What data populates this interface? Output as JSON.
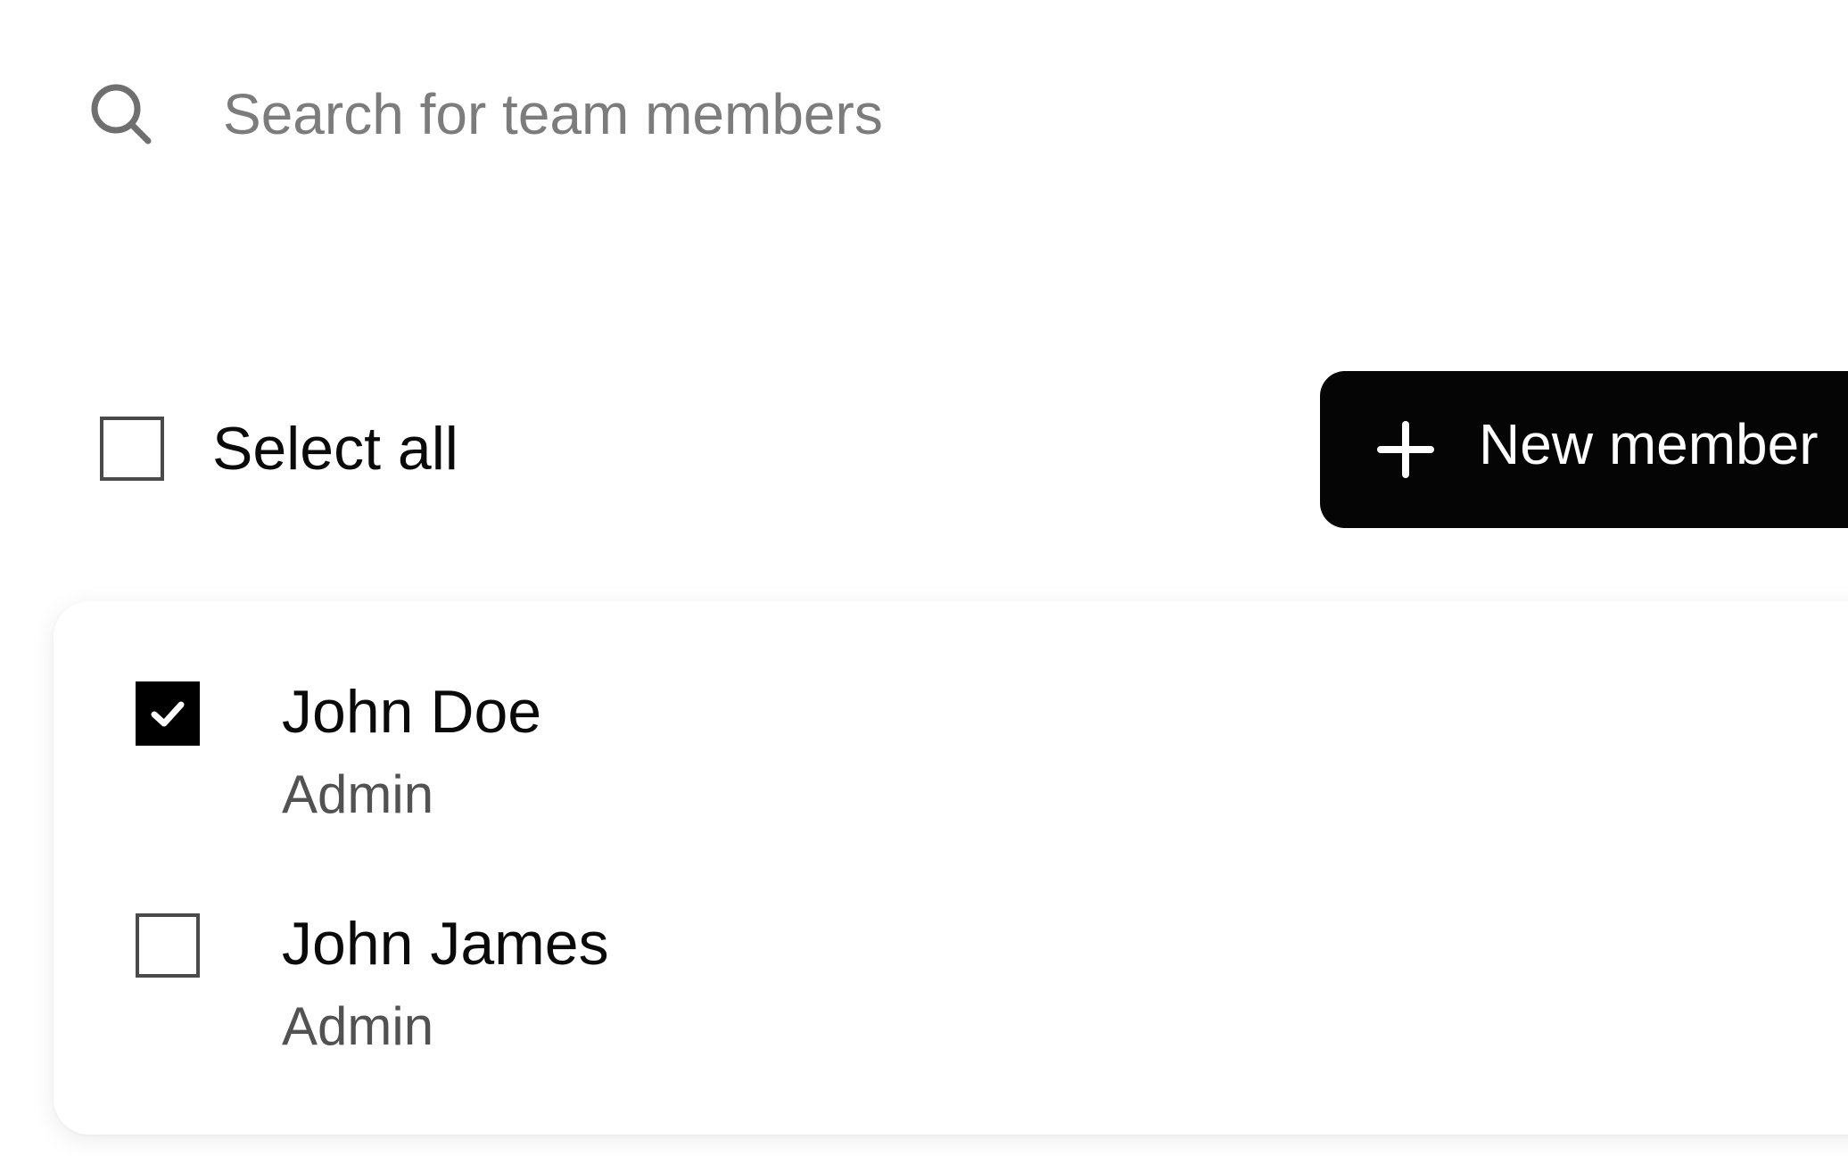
{
  "search": {
    "placeholder": "Search for team members",
    "value": "",
    "icon": "search-icon"
  },
  "toolbar": {
    "select_all_label": "Select all",
    "select_all_checked": false,
    "new_member_label": "New member",
    "new_member_icon": "plus-icon"
  },
  "members": [
    {
      "name": "John Doe",
      "role": "Admin",
      "checked": true
    },
    {
      "name": "John James",
      "role": "Admin",
      "checked": false
    }
  ],
  "colors": {
    "primary_button": "#050505",
    "checkbox_checked": "#000000",
    "placeholder_text": "#7c7c7c",
    "secondary_text": "#525252"
  }
}
